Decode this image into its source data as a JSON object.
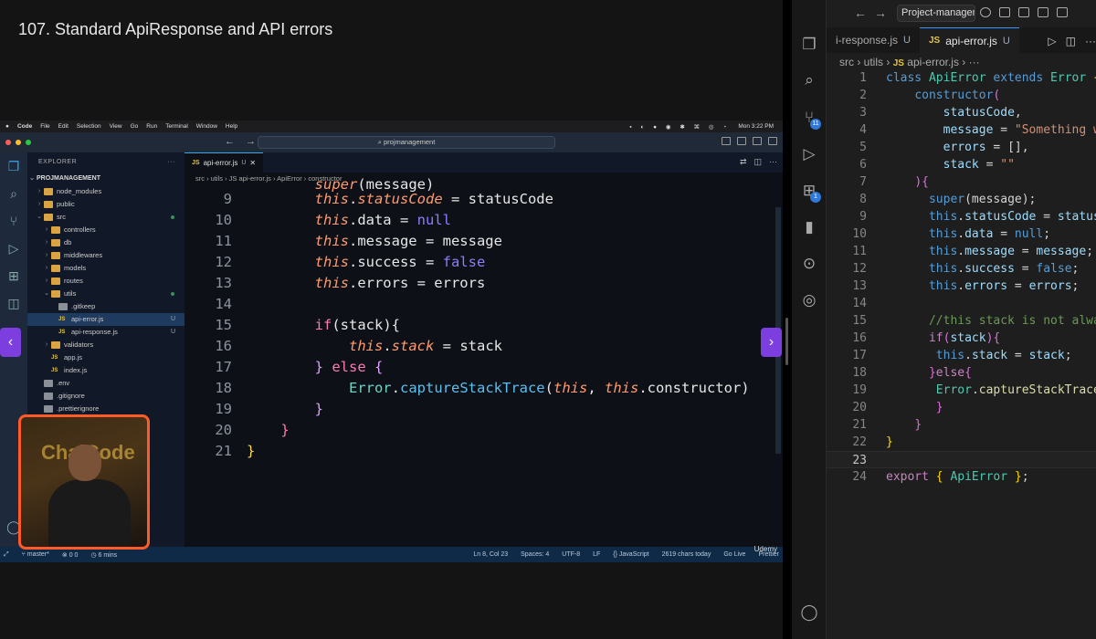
{
  "lecture": {
    "title": "107. Standard ApiResponse and API errors"
  },
  "mac_menu": {
    "items": [
      "Code",
      "File",
      "Edit",
      "Selection",
      "View",
      "Go",
      "Run",
      "Terminal",
      "Window",
      "Help"
    ],
    "clock": "Mon 3:22 PM"
  },
  "video_vscode": {
    "command_center": "projmanagement",
    "explorer": {
      "header": "EXPLORER",
      "root": "PROJMANAGEMENT",
      "items": [
        {
          "label": "node_modules",
          "depth": 1,
          "type": "folder",
          "open": false
        },
        {
          "label": "public",
          "depth": 1,
          "type": "folder",
          "open": false
        },
        {
          "label": "src",
          "depth": 1,
          "type": "folder",
          "open": true
        },
        {
          "label": "controllers",
          "depth": 2,
          "type": "folder",
          "open": false
        },
        {
          "label": "db",
          "depth": 2,
          "type": "folder",
          "open": false
        },
        {
          "label": "middlewares",
          "depth": 2,
          "type": "folder",
          "open": false
        },
        {
          "label": "models",
          "depth": 2,
          "type": "folder",
          "open": false
        },
        {
          "label": "routes",
          "depth": 2,
          "type": "folder",
          "open": false
        },
        {
          "label": "utils",
          "depth": 2,
          "type": "folder",
          "open": true
        },
        {
          "label": ".gitkeep",
          "depth": 3,
          "type": "file"
        },
        {
          "label": "api-error.js",
          "depth": 3,
          "type": "js",
          "badge": "U",
          "selected": true
        },
        {
          "label": "api-response.js",
          "depth": 3,
          "type": "js",
          "badge": "U"
        },
        {
          "label": "validators",
          "depth": 2,
          "type": "folder",
          "open": false
        },
        {
          "label": "app.js",
          "depth": 2,
          "type": "js"
        },
        {
          "label": "index.js",
          "depth": 2,
          "type": "js"
        },
        {
          "label": ".env",
          "depth": 1,
          "type": "file"
        },
        {
          "label": ".gitignore",
          "depth": 1,
          "type": "file"
        },
        {
          "label": ".prettierignore",
          "depth": 1,
          "type": "file"
        }
      ]
    },
    "tab": {
      "label": "api-error.js",
      "badge": "U",
      "lang": "JS"
    },
    "breadcrumb": "src  ›  utils  ›  JS  api-error.js  ›  ApiError  ›  constructor",
    "status": {
      "branch": "master*",
      "problems": "0  0",
      "time": "6 mins",
      "position": "Ln 8, Col 23",
      "spaces": "Spaces: 4",
      "encoding": "UTF-8",
      "eol": "LF",
      "language": "{} JavaScript",
      "chars": "2619 chars today",
      "golive": "Go Live",
      "prettier": "Prettier"
    },
    "watermark": "Udemy",
    "webcam_logo": "ChaiCode"
  },
  "right_vscode": {
    "command_center": "Project-managem",
    "tabs": [
      {
        "label": "i-response.js",
        "badge": "U",
        "active": false
      },
      {
        "label": "api-error.js",
        "badge": "U",
        "active": true,
        "lang": "JS"
      }
    ],
    "breadcrumb": {
      "a": "src",
      "b": "utils",
      "c": "api-error.js"
    },
    "activity_badges": {
      "scm": "11",
      "extensions": "1"
    }
  },
  "colors": {
    "accent": "#7d3ee0",
    "webcam_border": "#ff5a2a",
    "statusbar": "#0f2a47"
  }
}
